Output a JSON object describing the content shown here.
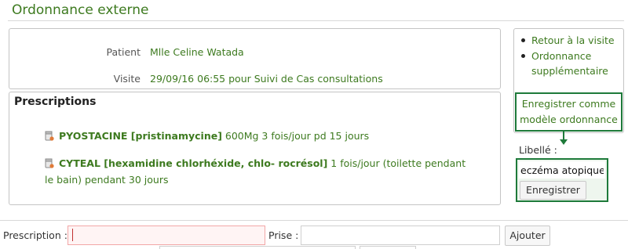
{
  "header": {
    "title": "Ordonnance externe"
  },
  "patient": {
    "patient_label": "Patient",
    "patient_value": "Mlle Celine Watada",
    "visit_label": "Visite",
    "visit_value": "29/09/16 06:55 pour Suivi de Cas consultations"
  },
  "prescriptions": {
    "heading": "Prescriptions",
    "items": [
      {
        "drug": "PYOSTACINE [pristinamycine]",
        "detail": " 600Mg 3 fois/jour pd 15 jours"
      },
      {
        "drug": "CYTEAL [hexamidine chlorhéxide, chlo- rocrésol]",
        "detail": " 1 fois/jour (toilette pendant le bain) pendant 30 jours"
      }
    ],
    "icon": "medication-icon"
  },
  "sidebar": {
    "links": [
      {
        "label": "Retour à la visite"
      },
      {
        "label": "Ordonnance supplémentaire"
      }
    ],
    "model_button_label": "Enregistrer comme modèle ordonnance",
    "libelle_label": "Libellé :",
    "libelle_value": "eczéma atopique",
    "save_button_label": "Enregistrer"
  },
  "form": {
    "prescription_label": "Prescription :",
    "prescription_value": "",
    "prise_label": "Prise :",
    "prise_value": "",
    "add_button_label": "Ajouter"
  },
  "colors": {
    "accent_green": "#3d7a1f",
    "highlight_border": "#1e7a3a",
    "error_border": "#f2a7a7"
  }
}
